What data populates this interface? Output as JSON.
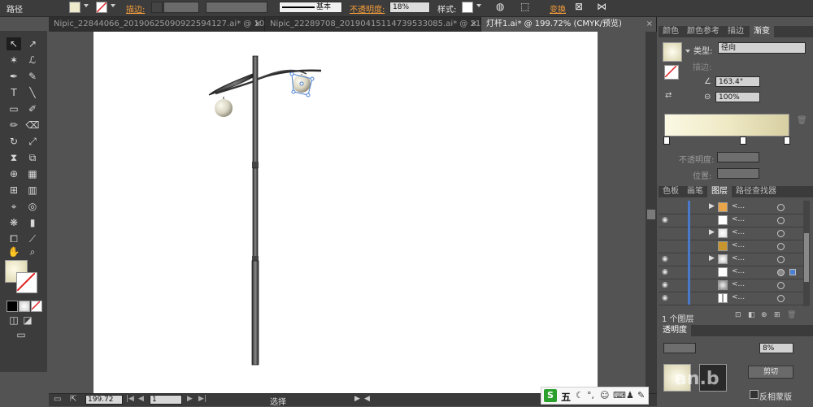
{
  "control_bar": {
    "path_label": "路径",
    "stroke_label": "描边:",
    "stroke_profile": "基本",
    "opacity_label": "不透明度:",
    "opacity_value": "18%",
    "style_label": "样式:",
    "transform_label": "变换"
  },
  "doc_tabs": [
    {
      "label": "Nipic_22844066_20190625090922594127.ai* @ 10...",
      "active": false
    },
    {
      "label": "Nipic_22289708_20190415114739533085.ai* @ 21...",
      "active": false
    },
    {
      "label": "灯杆1.ai* @ 199.72% (CMYK/预览)",
      "active": true
    }
  ],
  "gradient_panel": {
    "tabs": [
      "颜色",
      "颜色参考",
      "描边",
      "渐变"
    ],
    "active_tab": "渐变",
    "type_label": "类型:",
    "type_value": "径向",
    "stroke_label": "描边:",
    "angle_value": "163.4°",
    "aspect_value": "100%",
    "opacity_label": "不透明度:",
    "location_label": "位置:"
  },
  "layers_panel": {
    "tabs": [
      "色板",
      "画笔",
      "图层",
      "路径查找器"
    ],
    "active_tab": "图层",
    "rows": [
      {
        "name": "<...",
        "visible": false,
        "expand": true
      },
      {
        "name": "<...",
        "visible": true,
        "expand": false
      },
      {
        "name": "<...",
        "visible": false,
        "expand": true
      },
      {
        "name": "<...",
        "visible": false,
        "expand": false
      },
      {
        "name": "<...",
        "visible": true,
        "expand": true
      },
      {
        "name": "<...",
        "visible": true,
        "expand": false
      },
      {
        "name": "<...",
        "visible": true,
        "expand": false
      },
      {
        "name": "<...",
        "visible": true,
        "expand": false
      }
    ],
    "footer": "1 个图层"
  },
  "transparency_panel": {
    "title": "透明度",
    "opacity_value": "8%",
    "invert_mask_label": "反相蒙版",
    "clip_label": "剪切"
  },
  "status_bar": {
    "zoom": "199.72",
    "page": "1",
    "status_text": "选择"
  },
  "ime": {
    "label": "五"
  },
  "watermark": "an.b"
}
